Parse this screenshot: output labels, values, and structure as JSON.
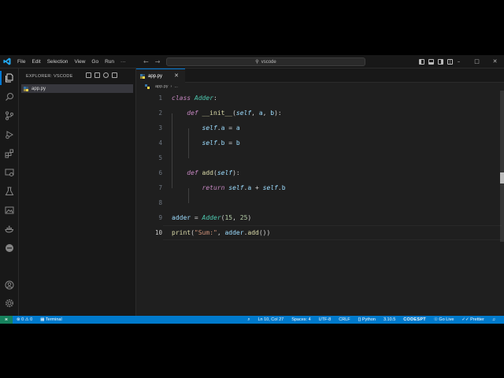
{
  "titlebar": {
    "menu": [
      "File",
      "Edit",
      "Selection",
      "View",
      "Go",
      "Run",
      "···"
    ],
    "search_text": "vscode",
    "win_minimize": "–",
    "win_maximize": "□",
    "win_close": "✕"
  },
  "sidebar": {
    "header": "EXPLORER: VSCODE",
    "files": [
      {
        "name": "app.py",
        "selected": true
      }
    ]
  },
  "editor": {
    "tab_label": "app.py",
    "tab_close": "✕",
    "breadcrumb_file": "app.py",
    "breadcrumb_sep": "›",
    "breadcrumb_more": "...",
    "lines": [
      {
        "n": "1",
        "tokens": [
          [
            "kw",
            "class"
          ],
          [
            "op",
            " "
          ],
          [
            "cls",
            "Adder"
          ],
          [
            "op",
            ":"
          ]
        ]
      },
      {
        "n": "2",
        "tokens": [
          [
            "op",
            "    "
          ],
          [
            "kw",
            "def"
          ],
          [
            "op",
            " "
          ],
          [
            "fn",
            "__init__"
          ],
          [
            "op",
            "("
          ],
          [
            "self",
            "self"
          ],
          [
            "op",
            ", "
          ],
          [
            "var",
            "a"
          ],
          [
            "op",
            ", "
          ],
          [
            "var",
            "b"
          ],
          [
            "op",
            "):"
          ]
        ]
      },
      {
        "n": "3",
        "tokens": [
          [
            "op",
            "        "
          ],
          [
            "self",
            "self"
          ],
          [
            "op",
            "."
          ],
          [
            "var",
            "a"
          ],
          [
            "op",
            " = "
          ],
          [
            "var",
            "a"
          ]
        ]
      },
      {
        "n": "4",
        "tokens": [
          [
            "op",
            "        "
          ],
          [
            "self",
            "self"
          ],
          [
            "op",
            "."
          ],
          [
            "var",
            "b"
          ],
          [
            "op",
            " = "
          ],
          [
            "var",
            "b"
          ]
        ]
      },
      {
        "n": "5",
        "tokens": []
      },
      {
        "n": "6",
        "tokens": [
          [
            "op",
            "    "
          ],
          [
            "kw",
            "def"
          ],
          [
            "op",
            " "
          ],
          [
            "fn",
            "add"
          ],
          [
            "op",
            "("
          ],
          [
            "self",
            "self"
          ],
          [
            "op",
            "):"
          ]
        ]
      },
      {
        "n": "7",
        "tokens": [
          [
            "op",
            "        "
          ],
          [
            "kw",
            "return"
          ],
          [
            "op",
            " "
          ],
          [
            "self",
            "self"
          ],
          [
            "op",
            "."
          ],
          [
            "var",
            "a"
          ],
          [
            "op",
            " + "
          ],
          [
            "self",
            "self"
          ],
          [
            "op",
            "."
          ],
          [
            "var",
            "b"
          ]
        ]
      },
      {
        "n": "8",
        "tokens": []
      },
      {
        "n": "9",
        "tokens": [
          [
            "var",
            "adder"
          ],
          [
            "op",
            " = "
          ],
          [
            "cls",
            "Adder"
          ],
          [
            "op",
            "("
          ],
          [
            "num",
            "15"
          ],
          [
            "op",
            ", "
          ],
          [
            "num",
            "25"
          ],
          [
            "op",
            ")"
          ]
        ]
      },
      {
        "n": "10",
        "tokens": [
          [
            "fn",
            "print"
          ],
          [
            "op",
            "("
          ],
          [
            "str",
            "\"Sum:\""
          ],
          [
            "op",
            ", "
          ],
          [
            "var",
            "adder"
          ],
          [
            "op",
            "."
          ],
          [
            "fn",
            "add"
          ],
          [
            "op",
            "())"
          ]
        ]
      }
    ]
  },
  "statusbar": {
    "remote": "⪤",
    "problems": "⊗ 0 ⚠ 0",
    "terminal": "Terminal",
    "zoom_icon": "⌕",
    "cursor_pos": "Ln 10, Col 27",
    "spaces": "Spaces: 4",
    "encoding": "UTF-8",
    "eol": "CRLF",
    "language": "Python",
    "python_version": "3.10.5",
    "brand": "CODESPT",
    "go_live": "Go Live",
    "prettier": "Prettier",
    "notifications_icon": "♫"
  },
  "colors": {
    "accent": "#0078d4",
    "statusbar": "#007acc",
    "keyword": "#c586c0",
    "class": "#4ec9b0",
    "function": "#dcdcaa",
    "variable": "#9cdcfe",
    "number": "#b5cea8",
    "string": "#ce9178"
  }
}
